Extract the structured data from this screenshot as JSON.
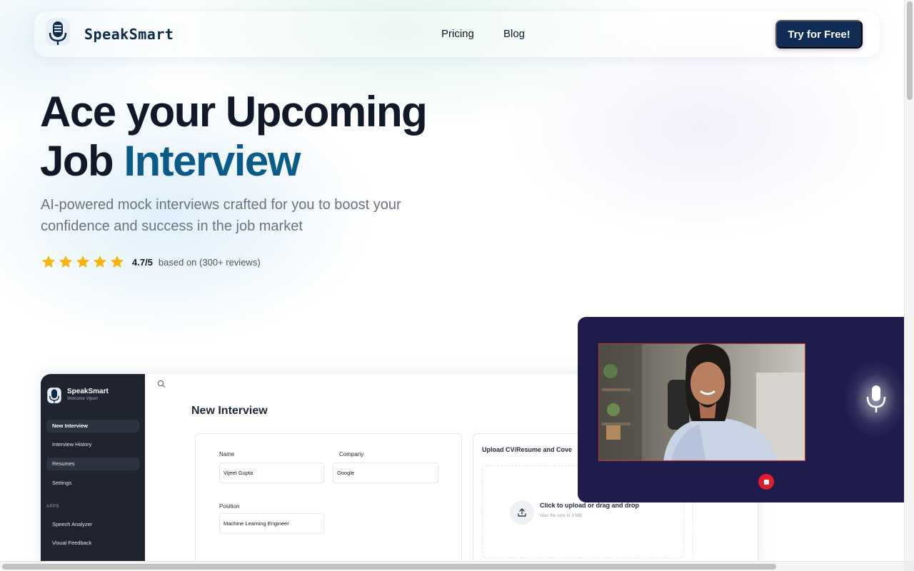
{
  "header": {
    "brand": "SpeakSmart",
    "nav": [
      {
        "label": "Pricing"
      },
      {
        "label": "Blog"
      }
    ],
    "cta_label": "Try for Free!"
  },
  "hero": {
    "title_line1": "Ace your Upcoming",
    "title_line2_plain": "Job ",
    "title_line2_accent": "Interview",
    "subtitle": "AI-powered mock interviews crafted for you to boost your confidence and success in the job market",
    "rating_value": 5,
    "rating_max": 5,
    "rating_score": "4.7/5",
    "rating_text": "based on (300+ reviews)"
  },
  "mockup": {
    "sidebar": {
      "brand": "SpeakSmart",
      "welcome": "Welcome Vijeet!",
      "items": [
        {
          "label": "New Interview"
        },
        {
          "label": "Interview History"
        },
        {
          "label": "Resumes"
        },
        {
          "label": "Settings"
        }
      ],
      "apps_heading": "APPS",
      "apps": [
        {
          "label": "Speech Analyzer"
        },
        {
          "label": "Visual Feedback"
        }
      ]
    },
    "page_title": "New Interview",
    "form": {
      "name_label": "Name",
      "name_value": "Vijeet Gupta",
      "company_label": "Company",
      "company_value": "Google",
      "position_label": "Position",
      "position_value": "Machine Learning Engineer"
    },
    "upload": {
      "title": "Upload CV/Resume and Cove",
      "prompt": "Click to upload or drag and drop",
      "limit": "Max file size is 3 MB"
    }
  },
  "colors": {
    "brand_navy": "#0f2c55",
    "accent_blue": "#0b5b8a",
    "star": "#f5b50a",
    "video_bg": "#1f1c4d",
    "record_red": "#e11d2b"
  },
  "icons": [
    "microphone-logo-icon",
    "star-icon",
    "search-icon",
    "upload-icon",
    "microphone-icon",
    "record-stop-icon"
  ]
}
